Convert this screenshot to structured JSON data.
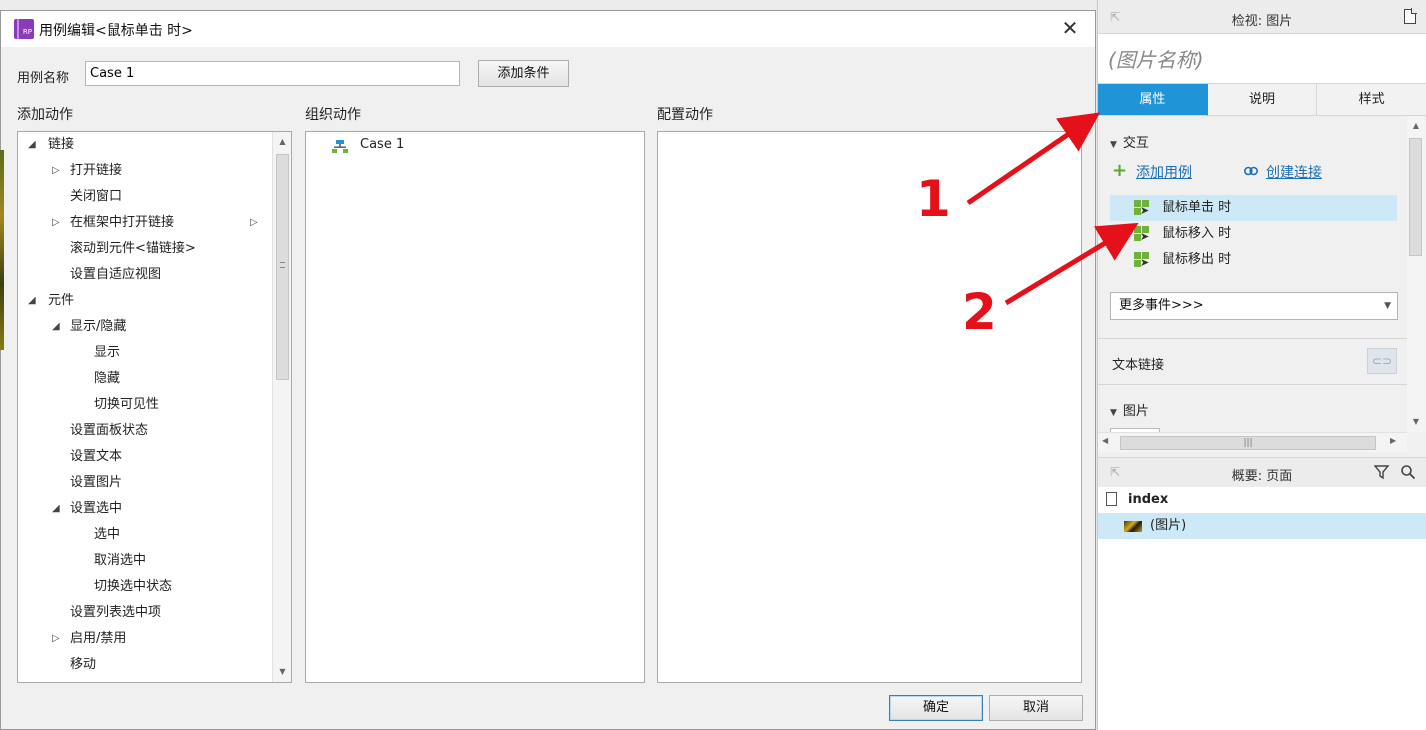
{
  "dialog": {
    "title": "用例编辑<鼠标单击 时>",
    "case_name_label": "用例名称",
    "case_name_value": "Case 1",
    "add_condition_label": "添加条件",
    "col_add_action": "添加动作",
    "col_organize_action": "组织动作",
    "col_configure_action": "配置动作",
    "ok_label": "确定",
    "cancel_label": "取消",
    "action_tree": [
      {
        "label": "链接",
        "level": 0,
        "toggle": "expanded"
      },
      {
        "label": "打开链接",
        "level": 1,
        "toggle": "collapsed"
      },
      {
        "label": "关闭窗口",
        "level": 1,
        "toggle": "none"
      },
      {
        "label": "在框架中打开链接",
        "level": 1,
        "toggle": "collapsed"
      },
      {
        "label": "滚动到元件<锚链接>",
        "level": 1,
        "toggle": "none"
      },
      {
        "label": "设置自适应视图",
        "level": 1,
        "toggle": "none"
      },
      {
        "label": "元件",
        "level": 0,
        "toggle": "expanded"
      },
      {
        "label": "显示/隐藏",
        "level": 1,
        "toggle": "expanded"
      },
      {
        "label": "显示",
        "level": 2,
        "toggle": "none"
      },
      {
        "label": "隐藏",
        "level": 2,
        "toggle": "none"
      },
      {
        "label": "切换可见性",
        "level": 2,
        "toggle": "none"
      },
      {
        "label": "设置面板状态",
        "level": 1,
        "toggle": "none"
      },
      {
        "label": "设置文本",
        "level": 1,
        "toggle": "none"
      },
      {
        "label": "设置图片",
        "level": 1,
        "toggle": "none"
      },
      {
        "label": "设置选中",
        "level": 1,
        "toggle": "expanded"
      },
      {
        "label": "选中",
        "level": 2,
        "toggle": "none"
      },
      {
        "label": "取消选中",
        "level": 2,
        "toggle": "none"
      },
      {
        "label": "切换选中状态",
        "level": 2,
        "toggle": "none"
      },
      {
        "label": "设置列表选中项",
        "level": 1,
        "toggle": "none"
      },
      {
        "label": "启用/禁用",
        "level": 1,
        "toggle": "collapsed"
      },
      {
        "label": "移动",
        "level": 1,
        "toggle": "none"
      }
    ],
    "organize_items": [
      {
        "label": "Case 1"
      }
    ]
  },
  "inspector": {
    "title": "检视: 图片",
    "image_name_placeholder": "(图片名称)",
    "tabs": [
      {
        "label": "属性",
        "active": true
      },
      {
        "label": "说明",
        "active": false
      },
      {
        "label": "样式",
        "active": false
      }
    ],
    "interaction_section": "交互",
    "add_case_link": "添加用例",
    "create_link_link": "创建连接",
    "events": [
      {
        "label": "鼠标单击 时",
        "selected": true
      },
      {
        "label": "鼠标移入 时",
        "selected": false
      },
      {
        "label": "鼠标移出 时",
        "selected": false
      }
    ],
    "more_events": "更多事件>>>",
    "text_link_label": "文本链接",
    "image_section": "图片"
  },
  "outline": {
    "title": "概要: 页面",
    "page_name": "index",
    "widget_name": "(图片)"
  },
  "annotations": {
    "label_1": "1",
    "label_2": "2",
    "color": "#e4101a"
  },
  "colors": {
    "accent": "#1f94d6",
    "selection": "#cde8f7",
    "link": "#1a6fb5",
    "event_icon": "#6fb23a"
  }
}
